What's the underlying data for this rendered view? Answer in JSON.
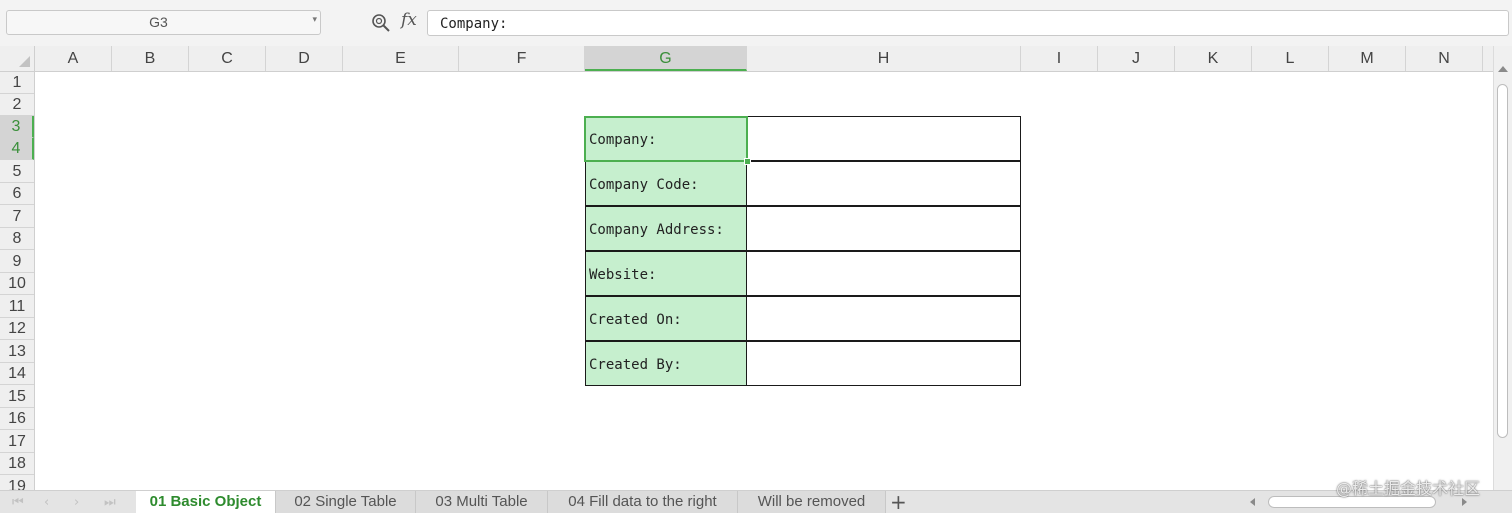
{
  "formula_bar": {
    "name_box": "G3",
    "fx_label": "fx",
    "formula_value": "Company:"
  },
  "columns": [
    "A",
    "B",
    "C",
    "D",
    "E",
    "F",
    "G",
    "H",
    "I",
    "J",
    "K",
    "L",
    "M",
    "N"
  ],
  "active_column": "G",
  "rows": [
    "1",
    "2",
    "3",
    "4",
    "5",
    "6",
    "7",
    "8",
    "9",
    "10",
    "11",
    "12",
    "13",
    "14",
    "15",
    "16",
    "17",
    "18",
    "19"
  ],
  "active_rows": [
    "3",
    "4"
  ],
  "form": [
    {
      "label": "Company:",
      "value": ""
    },
    {
      "label": "Company Code:",
      "value": ""
    },
    {
      "label": "Company Address:",
      "value": ""
    },
    {
      "label": "Website:",
      "value": ""
    },
    {
      "label": "Created On:",
      "value": ""
    },
    {
      "label": "Created By:",
      "value": ""
    }
  ],
  "sheet_tabs": [
    {
      "label": "01 Basic Object",
      "active": true
    },
    {
      "label": "02 Single Table",
      "active": false
    },
    {
      "label": "03 Multi Table",
      "active": false
    },
    {
      "label": "04 Fill data to the right",
      "active": false
    },
    {
      "label": "Will be removed",
      "active": false
    }
  ],
  "add_sheet_label": "+",
  "watermark": "@稀土掘金技术社区",
  "colors": {
    "label_fill": "#c6efce",
    "selection": "#4caf50",
    "active_tab_text": "#2e8b2e"
  }
}
